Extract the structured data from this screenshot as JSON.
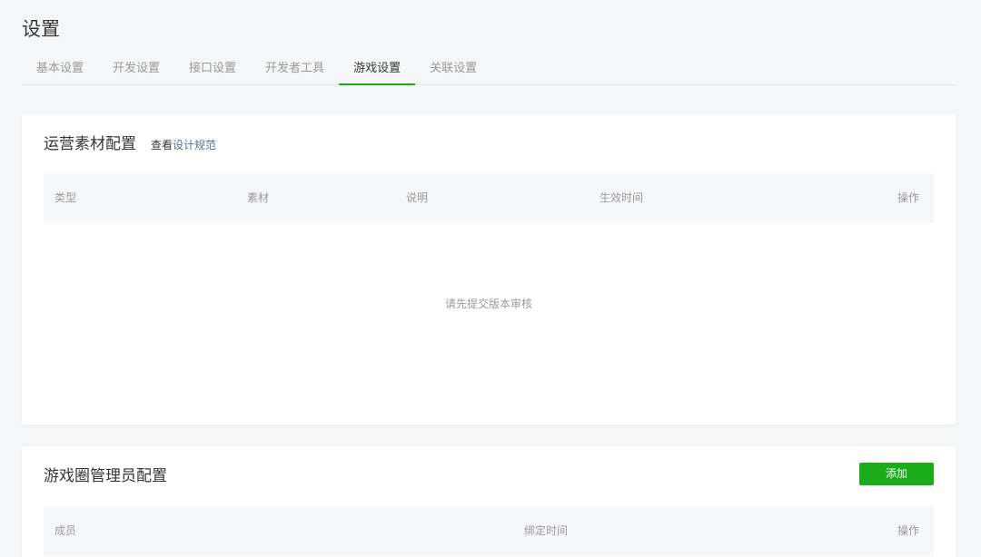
{
  "page": {
    "title": "设置"
  },
  "tabs": [
    {
      "label": "基本设置"
    },
    {
      "label": "开发设置"
    },
    {
      "label": "接口设置"
    },
    {
      "label": "开发者工具"
    },
    {
      "label": "游戏设置"
    },
    {
      "label": "关联设置"
    }
  ],
  "active_tab": "游戏设置",
  "material": {
    "title": "运营素材配置",
    "sub_prefix": "查看",
    "sub_link": "设计规范",
    "columns": [
      "类型",
      "素材",
      "说明",
      "生效时间",
      "操作"
    ],
    "empty_text": "请先提交版本审核"
  },
  "admin": {
    "title": "游戏圈管理员配置",
    "add_label": "添加",
    "columns": [
      "成员",
      "绑定时间",
      "操作"
    ]
  },
  "colors": {
    "accent": "#1aad19",
    "link": "#576b95"
  }
}
